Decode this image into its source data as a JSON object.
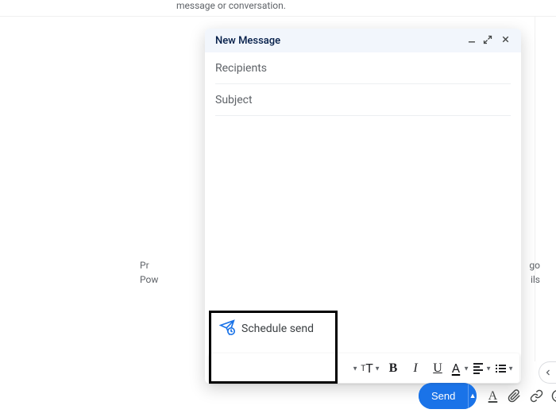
{
  "bgTextTop": "message or conversation.",
  "bgLeftLine1": "Pr",
  "bgLeftLine2": "Pow",
  "bgRightLine1": "go",
  "bgRightLine2": "ils",
  "compose": {
    "title": "New Message",
    "recipientsPlaceholder": "Recipients",
    "subjectPlaceholder": "Subject"
  },
  "schedule": {
    "label": "Schedule send"
  },
  "send": {
    "label": "Send"
  }
}
